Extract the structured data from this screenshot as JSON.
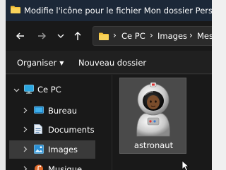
{
  "window": {
    "title": "Modifie l'icône pour le fichier Mon dossier Perso"
  },
  "nav": {
    "back_icon": "arrow-left-icon",
    "forward_icon": "arrow-right-icon",
    "dropdown_icon": "chevron-down-icon",
    "up_icon": "arrow-up-icon"
  },
  "address": {
    "crumbs": [
      "Ce PC",
      "Images",
      "Mes"
    ]
  },
  "commandbar": {
    "organize_label": "Organiser",
    "new_folder_label": "Nouveau dossier"
  },
  "sidebar": {
    "items": [
      {
        "label": "Ce PC",
        "icon": "computer-icon",
        "expanded": true
      },
      {
        "label": "Bureau",
        "icon": "desktop-icon"
      },
      {
        "label": "Documents",
        "icon": "documents-icon"
      },
      {
        "label": "Images",
        "icon": "images-icon",
        "selected": true
      },
      {
        "label": "Musique",
        "icon": "music-icon"
      }
    ]
  },
  "files": [
    {
      "name": "astronaut",
      "icon": "astronaut-icon",
      "selected": true
    }
  ],
  "colors": {
    "titlebar": "#1c2838",
    "background": "#191919",
    "folder": "#f3c13a",
    "selection": "#3a3a3a"
  }
}
